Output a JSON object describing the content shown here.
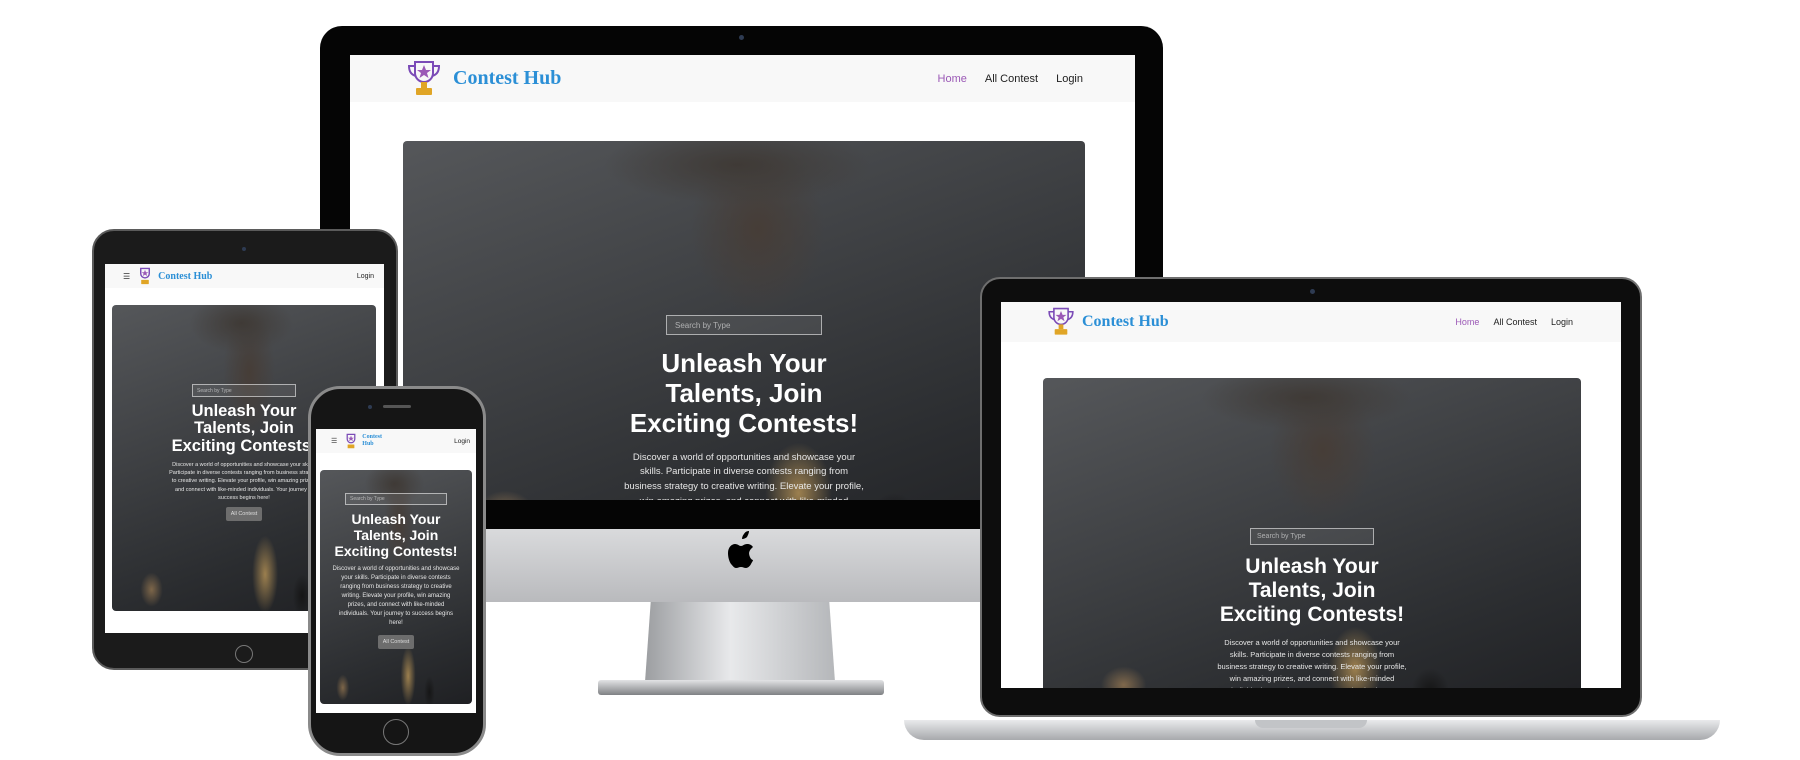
{
  "site": {
    "brand": "Contest Hub",
    "nav": {
      "home": "Home",
      "all_contest": "All Contest",
      "login": "Login"
    },
    "search_placeholder": "Search by Type",
    "hero_title": "Unleash Your Talents, Join Exciting Contests!",
    "hero_description": "Discover a world of opportunities and showcase your skills. Participate in diverse contests ranging from business strategy to creative writing. Elevate your profile, win amazing prizes, and connect with like-minded individuals. Your journey to success begins here!",
    "hero_button": "All Contest"
  },
  "colors": {
    "brand_blue": "#2b8fd6",
    "active_purple": "#9b59b6"
  },
  "icons": {
    "logo": "trophy-icon",
    "menu": "hamburger-icon",
    "platform": "apple-logo-icon"
  }
}
